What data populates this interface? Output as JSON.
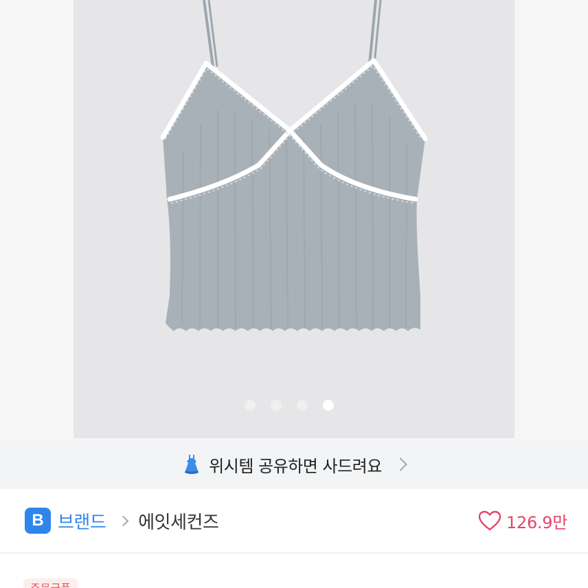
{
  "carousel": {
    "page_count": 4,
    "active_index": 3,
    "product_image": "gray-ribbed-camisole-with-white-lace-trim"
  },
  "share_banner": {
    "icon": "dress-icon",
    "text": "위시템 공유하면 사드려요",
    "chevron": "chevron-right-icon"
  },
  "brand_bar": {
    "badge_letter": "B",
    "brand_label": "브랜드",
    "separator": "chevron-right-icon",
    "brand_name": "에잇세컨즈",
    "like_icon": "heart-outline-icon",
    "like_count": "126.9만"
  },
  "lower": {
    "coupon_tag": "주문금품"
  },
  "colors": {
    "brand_blue": "#2f86ea",
    "like_pink": "#e4456b",
    "banner_bg": "#f3f4f6",
    "hero_bg": "#e6e6e8",
    "product_gray": "#a9b1b8"
  }
}
